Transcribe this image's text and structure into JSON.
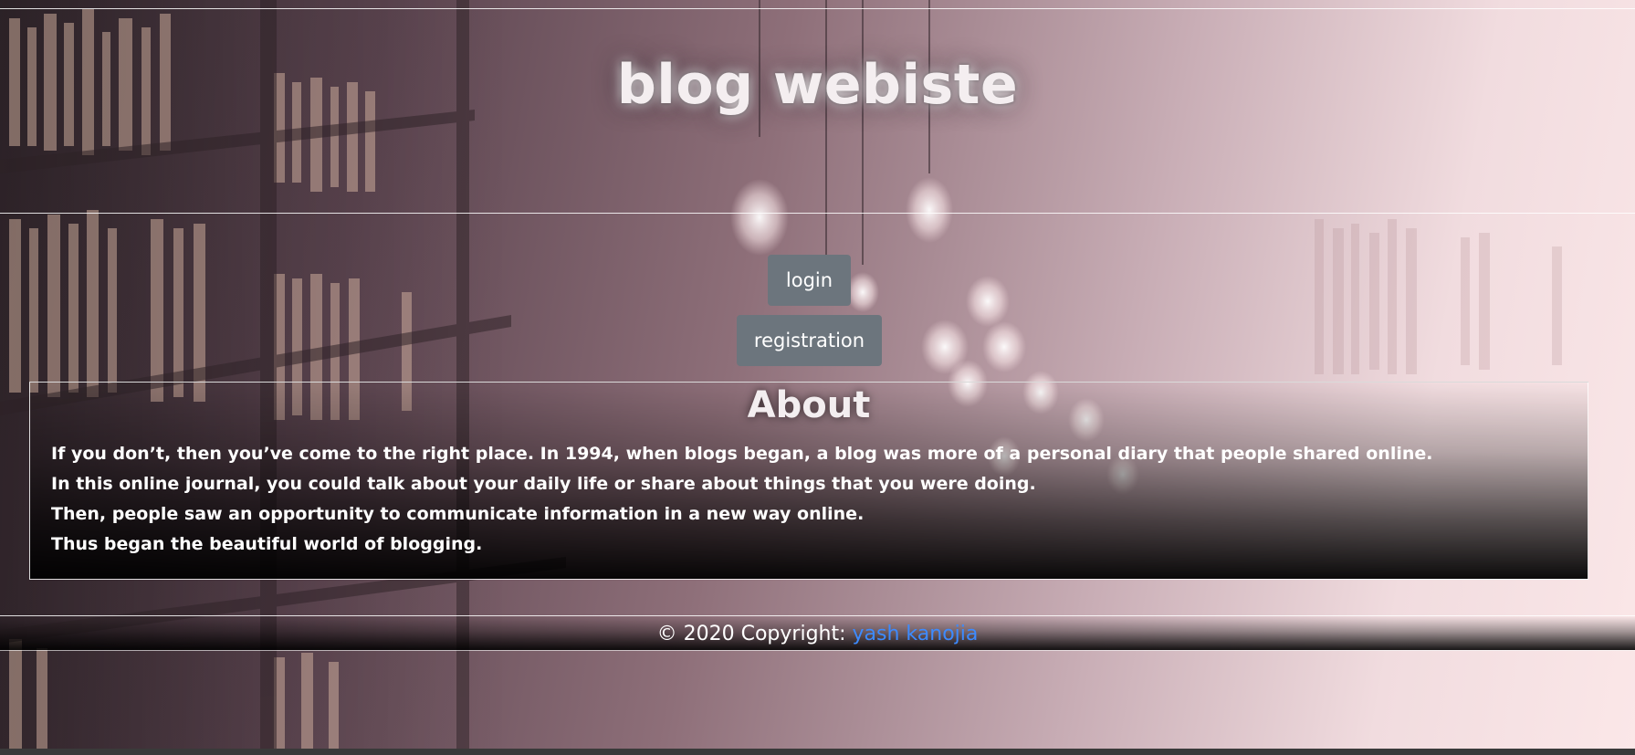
{
  "header": {
    "title": "blog webiste"
  },
  "nav": {
    "login_label": "login",
    "registration_label": "registration"
  },
  "about": {
    "heading": "About",
    "paragraphs": [
      "If you don’t, then you’ve come to the right place. In 1994, when blogs began, a blog was more of a personal diary that people shared online.",
      "In this online journal, you could talk about your daily life or share about things that you were doing.",
      "Then, people saw an opportunity to communicate information in a new way online.",
      "Thus began the beautiful world of blogging."
    ]
  },
  "footer": {
    "copyright_text": "© 2020 Copyright: ",
    "author_link": "yash kanojia"
  },
  "colors": {
    "button_bg": "#6c757d",
    "link": "#3d8bff",
    "text": "#ffffff"
  }
}
